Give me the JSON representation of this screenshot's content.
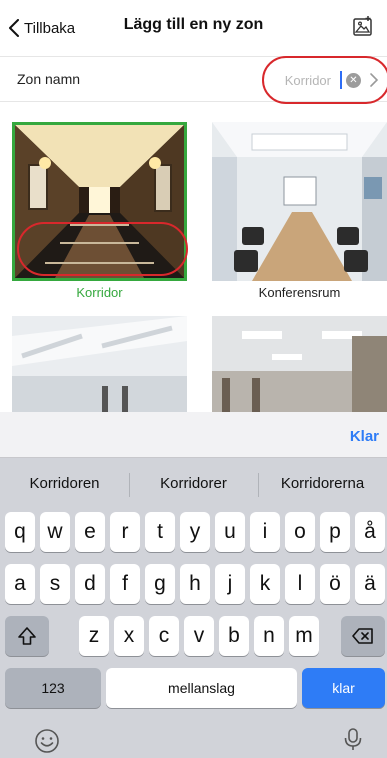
{
  "nav": {
    "back_label": "Tillbaka",
    "title": "Lägg till en ny zon",
    "photo_icon": "photo-icon"
  },
  "zone": {
    "label": "Zon namn",
    "value": "Korridor"
  },
  "tiles": [
    {
      "label": "Korridor",
      "selected": true
    },
    {
      "label": "Konferensrum",
      "selected": false
    }
  ],
  "keyboard": {
    "done_label": "Klar",
    "suggestions": [
      "Korridoren",
      "Korridorer",
      "Korridorerna"
    ],
    "row1": [
      "q",
      "w",
      "e",
      "r",
      "t",
      "y",
      "u",
      "i",
      "o",
      "p",
      "å"
    ],
    "row2": [
      "a",
      "s",
      "d",
      "f",
      "g",
      "h",
      "j",
      "k",
      "l",
      "ö",
      "ä"
    ],
    "row3": [
      "z",
      "x",
      "c",
      "v",
      "b",
      "n",
      "m"
    ],
    "numbers_label": "123",
    "space_label": "mellanslag",
    "return_label": "klar"
  },
  "colors": {
    "selected_green": "#35a83e",
    "annotation_red": "#d8282c",
    "accent_blue": "#2e7cf6"
  }
}
